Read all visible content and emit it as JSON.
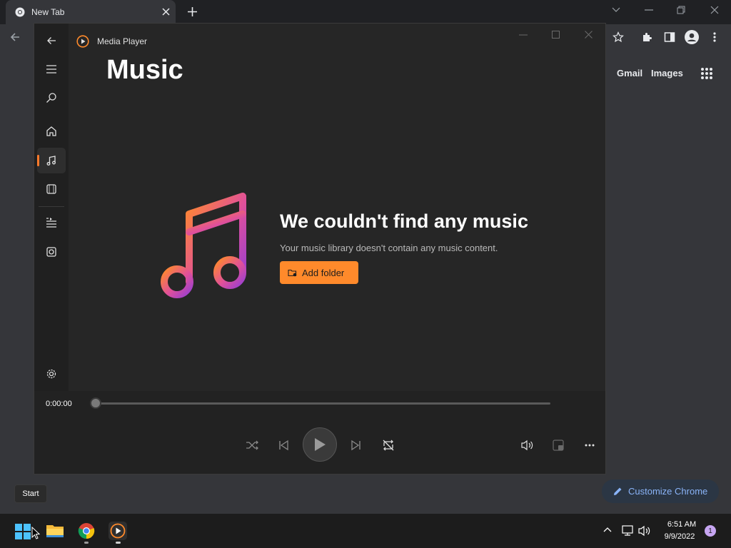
{
  "chrome": {
    "tab_title": "New Tab",
    "links": {
      "gmail": "Gmail",
      "images": "Images"
    },
    "customize_label": "Customize Chrome"
  },
  "media_player": {
    "window_title": "Media Player",
    "heading": "Music",
    "empty_title": "We couldn't find any music",
    "empty_subtitle": "Your music library doesn't contain any music content.",
    "add_folder_label": "Add folder",
    "time_elapsed": "0:00:00",
    "progress": 0,
    "accent_color": "#ff8a2b"
  },
  "taskbar": {
    "tooltip": "Start",
    "time": "6:51 AM",
    "date": "9/9/2022",
    "notification_count": "1"
  }
}
